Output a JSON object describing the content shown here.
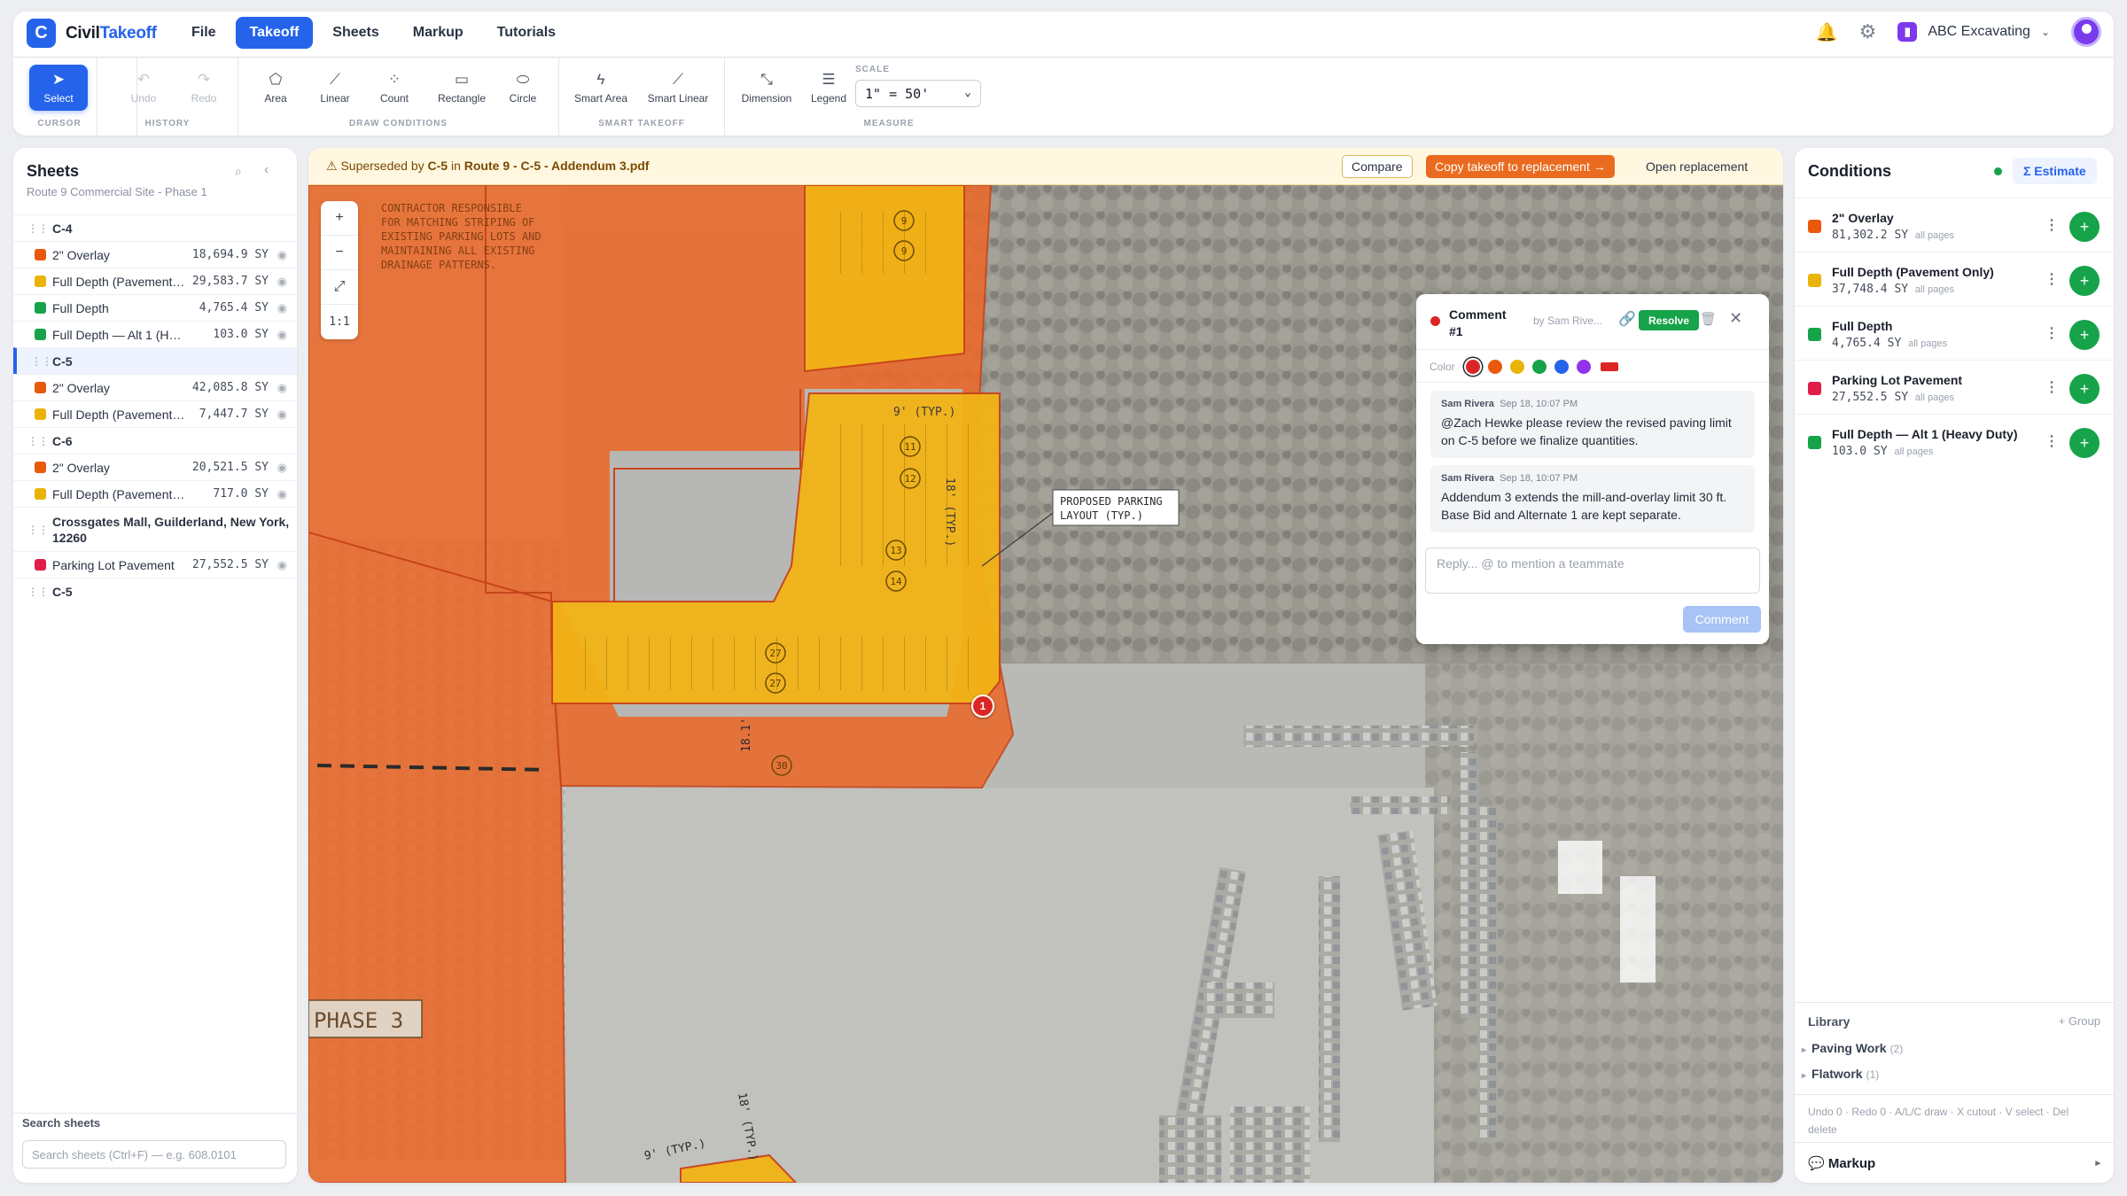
{
  "app": {
    "brand_prefix": "Civil",
    "brand_suffix": "Takeoff",
    "logo_letter": "C"
  },
  "nav": {
    "items": [
      {
        "label": "File",
        "active": false
      },
      {
        "label": "Takeoff",
        "active": true
      },
      {
        "label": "Sheets",
        "active": false
      },
      {
        "label": "Markup",
        "active": false
      },
      {
        "label": "Tutorials",
        "active": false
      }
    ],
    "org_badge": "▮",
    "org_name": "ABC Excavating",
    "icons": [
      "bell-icon",
      "gear-icon",
      "org-icon",
      "avatar"
    ]
  },
  "toolbar": {
    "groups": {
      "cursor": "CURSOR",
      "history": "HISTORY",
      "draw": "DRAW CONDITIONS",
      "smart": "SMART TAKEOFF",
      "measure": "MEASURE"
    },
    "select": "Select",
    "undo": "Undo",
    "redo": "Redo",
    "area": "Area",
    "linear": "Linear",
    "count": "Count",
    "rectangle": "Rectangle",
    "circle": "Circle",
    "smart_area": "Smart Area",
    "smart_linear": "Smart Linear",
    "dimension": "Dimension",
    "legend": "Legend",
    "scale_label": "SCALE",
    "scale_value": "1\" = 50'"
  },
  "sheets": {
    "title": "Sheets",
    "subtitle": "Route 9 Commercial Site - Phase 1",
    "groups": [
      {
        "name": "C-4",
        "selected": false,
        "items": [
          {
            "name": "2\" Overlay",
            "value": "18,694.9 SY",
            "color": "#ea580c"
          },
          {
            "name": "Full Depth (Pavement Only)",
            "value": "29,583.7 SY",
            "color": "#eab308"
          },
          {
            "name": "Full Depth",
            "value": "4,765.4 SY",
            "color": "#16a34a"
          },
          {
            "name": "Full Depth — Alt 1 (Heavy Duty)",
            "value": "103.0 SY",
            "color": "#16a34a"
          }
        ]
      },
      {
        "name": "C-5",
        "selected": true,
        "items": [
          {
            "name": "2\" Overlay",
            "value": "42,085.8 SY",
            "color": "#ea580c"
          },
          {
            "name": "Full Depth (Pavement Only)",
            "value": "7,447.7 SY",
            "color": "#eab308"
          }
        ]
      },
      {
        "name": "C-6",
        "selected": false,
        "items": [
          {
            "name": "2\" Overlay",
            "value": "20,521.5 SY",
            "color": "#ea580c"
          },
          {
            "name": "Full Depth (Pavement Only)",
            "value": "717.0 SY",
            "color": "#eab308"
          }
        ]
      },
      {
        "name": "Crossgates Mall, Guilderland, New York, 12260",
        "selected": false,
        "tall": true,
        "items": [
          {
            "name": "Parking Lot Pavement",
            "value": "27,552.5 SY",
            "color": "#e11d48"
          }
        ]
      },
      {
        "name": "C-5",
        "selected": false,
        "items": []
      }
    ],
    "search_label": "Search sheets",
    "search_placeholder": "Search sheets (Ctrl+F) — e.g. 608.0101"
  },
  "banner": {
    "prefix": "⚠ Superseded by ",
    "sheet": "C-5",
    "mid": " in ",
    "doc": "Route 9 - C-5 - Addendum 3.pdf",
    "compare": "Compare",
    "copy": "Copy takeoff to replacement →",
    "open": "Open replacement"
  },
  "map": {
    "zoom_in": "+",
    "zoom_out": "−",
    "fit": "⤢",
    "one_to_one": "1:1",
    "pin": "1",
    "labels": {
      "note": [
        "CONTRACTOR RESPONSIBLE",
        "FOR MATCHING STRIPING OF",
        "EXISTING PARKING LOTS AND",
        "MAINTAINING ALL EXISTING",
        "DRAINAGE PATTERNS."
      ],
      "proposed": [
        "PROPOSED PARKING",
        "LAYOUT (TYP.)"
      ],
      "phase": "PHASE 3",
      "typ9": "9' (TYP.)",
      "typ18": "18' (TYP.)",
      "d18": "18.1'",
      "stalls": [
        "9",
        "9",
        "11",
        "12",
        "13",
        "14",
        "27",
        "27",
        "30"
      ]
    }
  },
  "comment": {
    "title": "Comment #1",
    "by": "by Sam Rive...",
    "resolve": "Resolve",
    "color_label": "Color",
    "colors": [
      "#dc2626",
      "#ea580c",
      "#eab308",
      "#16a34a",
      "#2563eb",
      "#9333ea"
    ],
    "messages": [
      {
        "author": "Sam Rivera",
        "time": "Sep 18, 10:07 PM",
        "body": "@Zach Hewke please review the revised paving limit on C-5 before we finalize quantities."
      },
      {
        "author": "Sam Rivera",
        "time": "Sep 18, 10:07 PM",
        "body": "Addendum 3 extends the mill-and-overlay limit 30 ft. Base Bid and Alternate 1 are kept separate."
      }
    ],
    "reply_placeholder": "Reply... @ to mention a teammate",
    "submit": "Comment"
  },
  "conditions": {
    "title": "Conditions",
    "estimate": "Σ Estimate",
    "items": [
      {
        "name": "2\" Overlay",
        "value": "81,302.2 SY",
        "scope": "all pages",
        "color": "#ea580c"
      },
      {
        "name": "Full Depth (Pavement Only)",
        "value": "37,748.4 SY",
        "scope": "all pages",
        "color": "#eab308"
      },
      {
        "name": "Full Depth",
        "value": "4,765.4 SY",
        "scope": "all pages",
        "color": "#16a34a"
      },
      {
        "name": "Parking Lot Pavement",
        "value": "27,552.5 SY",
        "scope": "all pages",
        "color": "#e11d48"
      },
      {
        "name": "Full Depth — Alt 1 (Heavy Duty)",
        "value": "103.0 SY",
        "scope": "all pages",
        "color": "#16a34a"
      }
    ],
    "library_title": "Library",
    "library_group": "+ Group",
    "library": [
      {
        "name": "Paving Work",
        "count": "(2)"
      },
      {
        "name": "Flatwork",
        "count": "(1)"
      }
    ],
    "shortcuts": "Undo 0 · Redo 0 · A/L/C draw · X cutout · V select · Del delete",
    "markup": "💬 Markup",
    "markup_arrow": "▸"
  }
}
